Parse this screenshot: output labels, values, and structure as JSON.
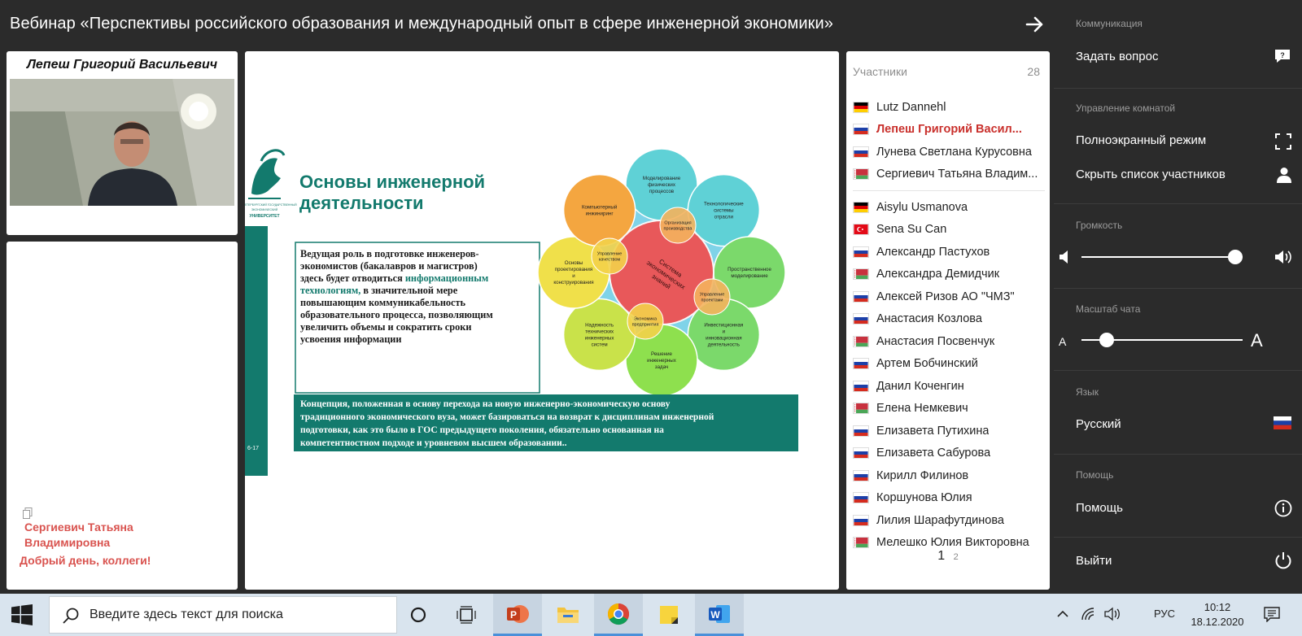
{
  "webinar": {
    "title": "Вебинар «Перспективы российского образования и международный опыт в сфере инженерной экономики»"
  },
  "speaker": {
    "name": "Лепеш Григорий Васильевич"
  },
  "chat": {
    "author": "Сергиевич Татьяна Владимировна",
    "message": "Добрый день, коллеги!"
  },
  "slide": {
    "heading_line1": "Основы инженерной",
    "heading_line2": "деятельности",
    "university_logo_text": "САНКТ-ПЕТЕРБУРГСКИЙ ГОСУДАРСТВЕННЫЙ ЭКОНОМИЧЕСКИЙ УНИВЕРСИТЕТ",
    "slide_number": "6-17",
    "box_lines": [
      "Ведущая роль в подготовке инженеров-",
      "экономистов (бакалавров и магистров)",
      "здесь будет отводиться",
      "технологиям,       в      значительной     мере",
      "повышающим         коммуникабельность",
      "образовательного процесса, позволяющим",
      "увеличить   объемы   и   сократить   сроки",
      "усвоения информации"
    ],
    "box_highlight_1": "информационным",
    "box_highlight_2": "технологиям,",
    "footer_lines": [
      "Концепция, положенная в основу перехода на новую инженерно-экономическую основу",
      "традиционного экономического вуза, может базироваться на возврат к дисциплинам инженерной",
      "подготовки, как это было в ГОС предыдущего поколения, обязательно основанная на",
      "компетентностном подходе и уровневом высшем образовании.."
    ],
    "diagram": {
      "center": "Система экономических знаний",
      "petals": [
        "Моделирование физических процессов",
        "Технологические системы отрасли",
        "Пространственное моделирование",
        "Инвестиционная и инновационная деятельность",
        "Решение инженерных задач",
        "Надежность технических инженерных систем",
        "Основы проектирования и конструирования",
        "Компьютерный инжиниринг"
      ],
      "inner": [
        "Организация производства",
        "Управление проектами",
        "Экономика предприятия",
        "Управление качеством"
      ]
    }
  },
  "participants": {
    "title": "Участники",
    "count": "28",
    "group1": [
      {
        "name": "Lutz Dannehl",
        "flag": "de"
      },
      {
        "name": "Лепеш Григорий Васил...",
        "flag": "ru",
        "speaker": true
      },
      {
        "name": "Лунева Светлана Курусовна",
        "flag": "ru"
      },
      {
        "name": "Сергиевич Татьяна Владим...",
        "flag": "by"
      }
    ],
    "group2": [
      {
        "name": "Aisylu Usmanova",
        "flag": "de"
      },
      {
        "name": "Sena Su Can",
        "flag": "tr"
      },
      {
        "name": "Александр Пастухов",
        "flag": "ru"
      },
      {
        "name": "Александра Демидчик",
        "flag": "by"
      },
      {
        "name": "Алексей Ризов АО \"ЧМЗ\"",
        "flag": "ru"
      },
      {
        "name": "Анастасия Козлова",
        "flag": "ru"
      },
      {
        "name": "Анастасия Посвенчук",
        "flag": "by"
      },
      {
        "name": "Артем Бобчинский",
        "flag": "ru"
      },
      {
        "name": "Данил Коченгин",
        "flag": "ru"
      },
      {
        "name": "Елена Немкевич",
        "flag": "by"
      },
      {
        "name": "Елизавета Путихина",
        "flag": "ru"
      },
      {
        "name": "Елизавета Сабурова",
        "flag": "ru"
      },
      {
        "name": "Кирилл Филинов",
        "flag": "ru"
      },
      {
        "name": "Коршунова Юлия",
        "flag": "ru"
      },
      {
        "name": "Лилия Шарафутдинова",
        "flag": "ru"
      },
      {
        "name": "Мелешко Юлия Викторовна",
        "flag": "by"
      }
    ],
    "pages": [
      "1",
      "2"
    ]
  },
  "settings": {
    "communication_section": "Коммуникация",
    "ask_question": "Задать вопрос",
    "room_section": "Управление комнатой",
    "fullscreen": "Полноэкранный режим",
    "hide_participants": "Скрыть список участников",
    "volume_section": "Громкость",
    "volume_level": 1.0,
    "chat_scale_section": "Масштаб чата",
    "chat_scale_small": "A",
    "chat_scale_large": "A",
    "chat_scale_level": 0.12,
    "language_section": "Язык",
    "language": "Русский",
    "help_section": "Помощь",
    "help": "Помощь",
    "exit": "Выйти"
  },
  "taskbar": {
    "search_placeholder": "Введите здесь текст для поиска",
    "apps": [
      "task-view-icon",
      "powerpoint-icon",
      "file-explorer-icon",
      "chrome-icon",
      "sticky-notes-icon",
      "word-icon"
    ],
    "language": "РУС",
    "time": "10:12",
    "date": "18.12.2020"
  },
  "colors": {
    "panel_bg": "#2b2b2b",
    "speaker_red": "#c9302c",
    "teal": "#137a6d"
  }
}
